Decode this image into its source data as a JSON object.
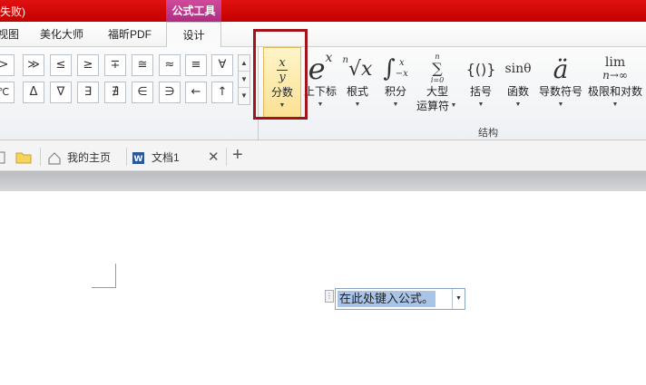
{
  "titlebar": {
    "title_fragment": "失败)",
    "context_tab": "公式工具"
  },
  "tabs": [
    {
      "label": "视图"
    },
    {
      "label": "美化大师"
    },
    {
      "label": "福昕PDF"
    },
    {
      "label": "设计"
    }
  ],
  "symbols_row1": [
    ">",
    "≫",
    "≤",
    "≥",
    "∓",
    "≅",
    "≈",
    "≡",
    "∀"
  ],
  "symbols_row2": [
    "℃",
    "Δ",
    "∇",
    "∃",
    "∄",
    "∈",
    "∋",
    "←",
    "↑"
  ],
  "structures": [
    {
      "name": "fraction",
      "label": "分数"
    },
    {
      "name": "script",
      "label": "上下标"
    },
    {
      "name": "radical",
      "label": "根式"
    },
    {
      "name": "integral",
      "label": "积分"
    },
    {
      "name": "large-operator",
      "label": "大型",
      "label2": "运算符"
    },
    {
      "name": "bracket",
      "label": "括号"
    },
    {
      "name": "function",
      "label": "函数"
    },
    {
      "name": "accent",
      "label": "导数符号"
    },
    {
      "name": "limit-log",
      "label": "极限和对数"
    }
  ],
  "structures_group_label": "结构",
  "glyph_text": {
    "fraction_num": "x",
    "fraction_den": "y",
    "script_base": "e",
    "script_exp": "x",
    "radical_index": "n",
    "radical_body": "√x",
    "integral_upper": "x",
    "integral_sign": "∫",
    "integral_lower": "−x",
    "sum_upper": "n",
    "sum_sign": "∑",
    "sum_lower": "i=0",
    "bracket": "{()}",
    "function": "sinθ",
    "accent": "ä",
    "limit_top": "lim",
    "limit_bottom": "n→∞"
  },
  "doc_tabs": [
    {
      "label": "我的主页"
    },
    {
      "label": "文档1"
    }
  ],
  "document": {
    "equation_placeholder": "在此处键入公式。"
  },
  "colors": {
    "titlebar_red": "#d20000",
    "context_magenta": "#c03c90",
    "highlight_gold": "#fbe092",
    "annotation_red": "#a0141a"
  }
}
